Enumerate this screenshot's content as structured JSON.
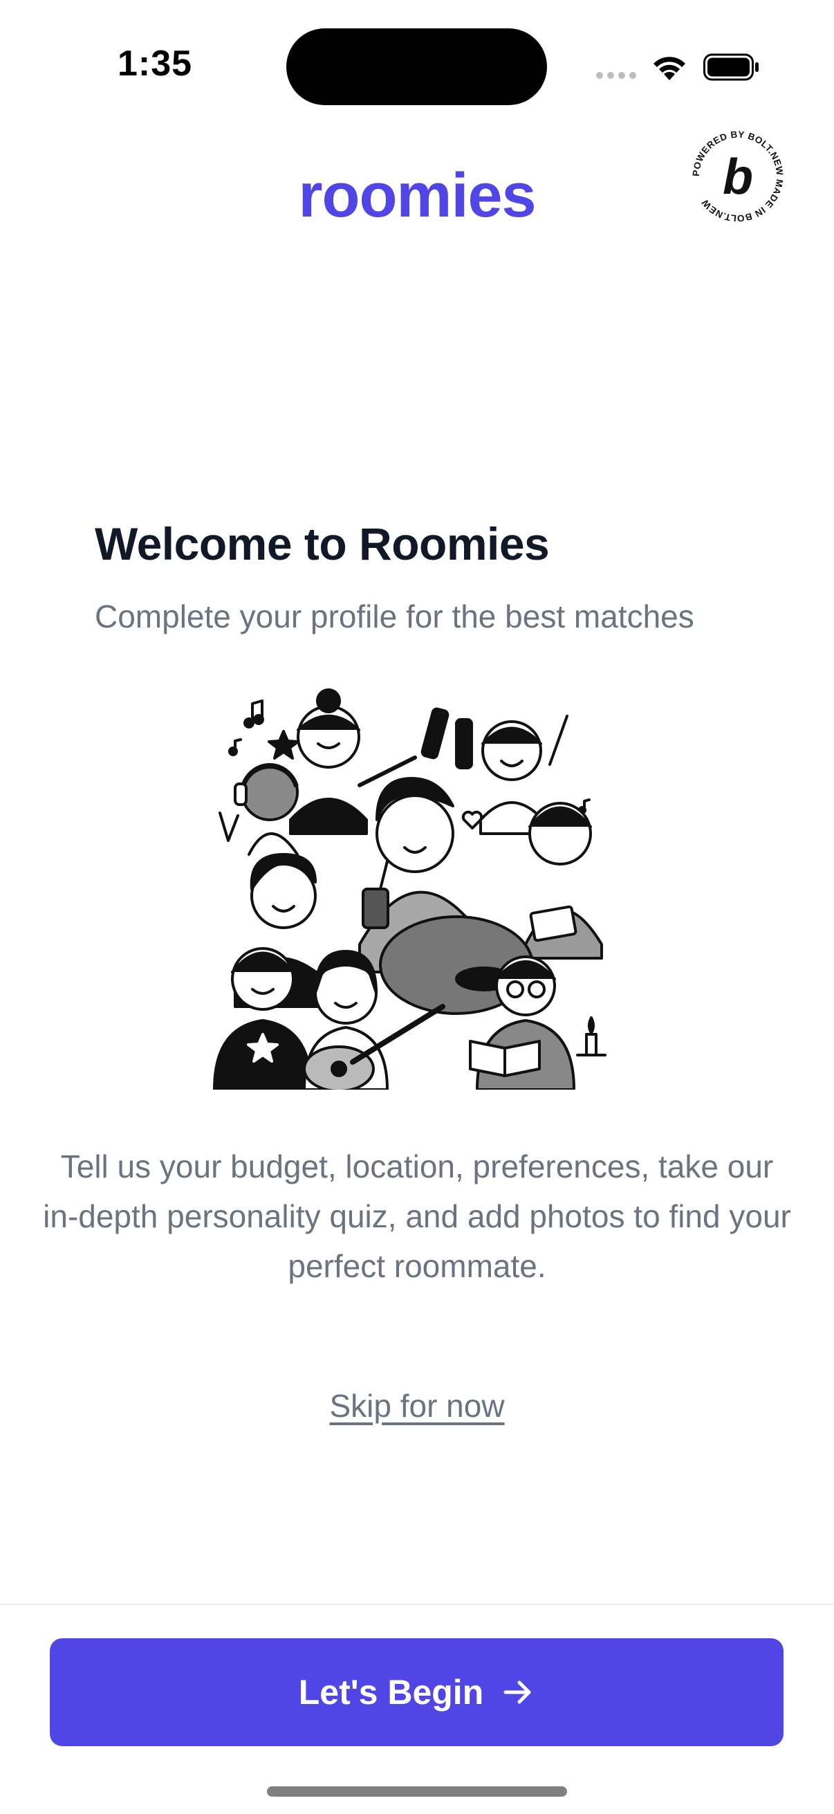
{
  "status_bar": {
    "time": "1:35",
    "wifi_icon": "wifi-icon",
    "battery_icon": "battery-icon"
  },
  "header": {
    "logo_text": "roomies",
    "badge_icon": "bolt-badge-icon",
    "badge_text": "POWERED BY BOLT.NEW MADE IN BOLT.NEW",
    "badge_letter": "b"
  },
  "welcome": {
    "title": "Welcome to Roomies",
    "subtitle": "Complete your profile for the best matches",
    "illustration_icon": "friends-group-illustration",
    "description": "Tell us your budget, location, preferences, take our in-depth personality quiz, and add photos to find your perfect roommate."
  },
  "actions": {
    "skip_label": "Skip for now",
    "primary_label": "Let's Begin",
    "primary_icon": "arrow-right-icon"
  },
  "colors": {
    "brand": "#4f46e5",
    "title": "#111827",
    "muted": "#6b7280"
  }
}
